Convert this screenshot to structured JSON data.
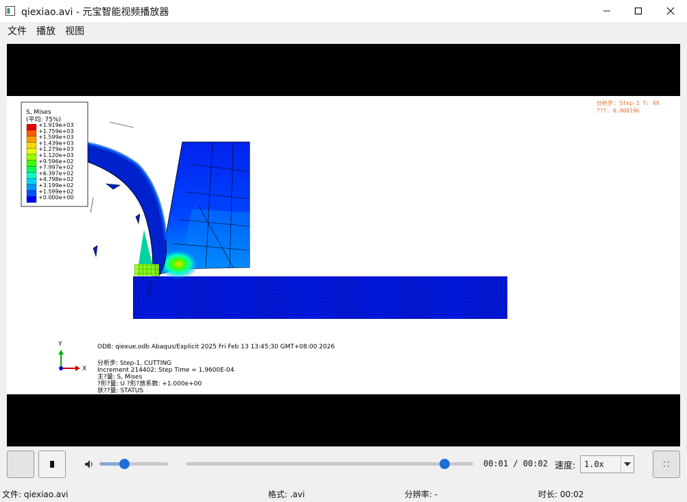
{
  "window": {
    "title": "qiexiao.avi - 元宝智能视频播放器",
    "icons": [
      "app-icon",
      "minimize-icon",
      "maximize-icon",
      "close-icon"
    ]
  },
  "menu": {
    "items": [
      "文件",
      "播放",
      "视图"
    ]
  },
  "frame": {
    "legend_title": "S, Mises",
    "legend_subtitle": "(平均: 75%)",
    "legend_values": [
      "+1.919e+03",
      "+1.759e+03",
      "+1.599e+03",
      "+1.439e+03",
      "+1.279e+03",
      "+1.120e+03",
      "+9.596e+02",
      "+7.997e+02",
      "+6.397e+02",
      "+4.798e+02",
      "+3.199e+02",
      "+1.599e+02",
      "+0.000e+00"
    ],
    "legend_colors": [
      "#e60000",
      "#ff5a00",
      "#ffa000",
      "#ffd400",
      "#e6ff00",
      "#96ff00",
      "#3cff00",
      "#00ff5a",
      "#00ffc8",
      "#00d2ff",
      "#0096ff",
      "#0050ff",
      "#0000ff"
    ],
    "step_label": "分析步: Step-1    T: 49",
    "time_label": "???: 0.000196",
    "axis_y": "Y",
    "axis_x": "X",
    "info_lines": [
      "ODB: qiexue.odb    Abaqus/Explicit 2025    Fri Feb 13 13:45:30 GMT+08:00 2026",
      "分析步: Step-1, CUTTING",
      "Increment    214402: Step Time =    1.9600E-04",
      "主?量: S, Mises",
      "?形?量: U   ?形?放系数: +1.000e+00",
      "状??量: STATUS"
    ]
  },
  "controls": {
    "play_icon": "blank",
    "stop_icon": "stop-square",
    "volume_icon": "speaker-icon",
    "volume_level": 0.36,
    "progress": 0.9,
    "time_display": "00:01 / 00:02",
    "speed_label": "速度:",
    "speed_value": "1.0x",
    "fullscreen_icon": "dots-grid-icon"
  },
  "status": {
    "file": "文件: qiexiao.avi",
    "format": "格式: .avi",
    "resolution": "分辨率: -",
    "duration": "时长: 00:02"
  }
}
